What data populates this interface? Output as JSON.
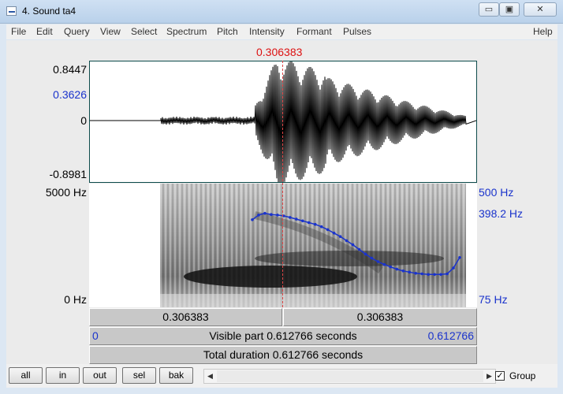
{
  "window": {
    "title": "4. Sound ta4",
    "min_glyph": "▭",
    "max_glyph": "▣",
    "close_glyph": "✕"
  },
  "menu": [
    "File",
    "Edit",
    "Query",
    "View",
    "Select",
    "Spectrum",
    "Pitch",
    "Intensity",
    "Formant",
    "Pulses"
  ],
  "help": "Help",
  "cursor_time": "0.306383",
  "waveform": {
    "y_max": "0.8447",
    "y_cursor": "0.3626",
    "y_zero": "0",
    "y_min": "-0.8981"
  },
  "spectrogram": {
    "freq_top": "5000 Hz",
    "freq_bottom": "0 Hz",
    "pitch_top": "500 Hz",
    "pitch_cursor": "398.2 Hz",
    "pitch_bottom": "75 Hz"
  },
  "bars": {
    "left_segment": "0.306383",
    "right_segment": "0.306383",
    "visible_start": "0",
    "visible_label": "Visible part 0.612766 seconds",
    "visible_end": "0.612766",
    "total_label": "Total duration 0.612766 seconds"
  },
  "toolbar": {
    "all": "all",
    "in": "in",
    "out": "out",
    "sel": "sel",
    "bak": "bak",
    "group_label": "Group",
    "group_checked": true
  },
  "colors": {
    "cursor": "#d11111",
    "pitch_track": "#1a33cc",
    "label_blue": "#1a33cc"
  },
  "pitch_track_hz": [
    376,
    392,
    398,
    394,
    392,
    389,
    384,
    378,
    372,
    366,
    360,
    352,
    342,
    330,
    318,
    304,
    290,
    274,
    258,
    244,
    232,
    222,
    214,
    206,
    200,
    196,
    192,
    190,
    188,
    188,
    188,
    190,
    210,
    246
  ]
}
